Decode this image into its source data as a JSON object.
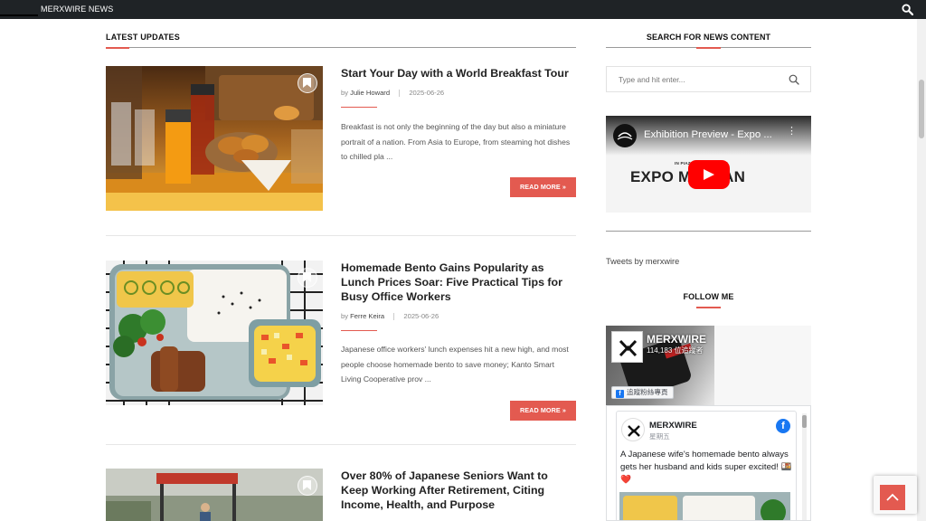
{
  "header": {
    "brand": "MERXWIRE NEWS"
  },
  "main": {
    "section_title": "LATEST UPDATES",
    "posts": [
      {
        "title": "Start Your Day with a World Breakfast Tour",
        "by": "by",
        "author": "Julie Howard",
        "date": "2025-06-26",
        "excerpt": "Breakfast is not only the beginning of the day but also a miniature portrait of a nation. From Asia to Europe, from steaming hot dishes to chilled pla ...",
        "read_more": "READ MORE »",
        "image": "breakfast-photo"
      },
      {
        "title": "Homemade Bento Gains Popularity as Lunch Prices Soar: Five Practical Tips for Busy Office Workers",
        "by": "by",
        "author": "Ferre Keira",
        "date": "2025-06-26",
        "excerpt": "Japanese office workers' lunch expenses hit a new high, and most people choose homemade bento to save money; Kanto Smart Living Cooperative prov ...",
        "read_more": "READ MORE »",
        "image": "bento-photo"
      },
      {
        "title": "Over 80% of Japanese Seniors Want to Keep Working After Retirement, Citing Income, Health, and Purpose",
        "image": "seniors-working-photo"
      }
    ]
  },
  "sidebar": {
    "search_title": "SEARCH FOR NEWS CONTENT",
    "search_placeholder": "Type and hit enter...",
    "video": {
      "title": "Exhibition Preview - Expo ...",
      "location": "IN PIAZZA ... ICO, MILAN",
      "big_text": "EXPO M      MILAN"
    },
    "tweets": "Tweets by merxwire",
    "follow_title": "FOLLOW ME",
    "facebook": {
      "page_name": "MERXWIRE",
      "followers": "114,183 位追蹤者",
      "follow_button": "追蹤粉絲專頁",
      "post_name": "MERXWIRE",
      "post_date": "星期五",
      "post_text": "A Japanese wife's homemade bento always gets her husband and kids super excited! 🍱❤️"
    }
  },
  "colors": {
    "accent": "#e35a50",
    "topbar": "#1f2326",
    "facebook": "#1877f2"
  }
}
